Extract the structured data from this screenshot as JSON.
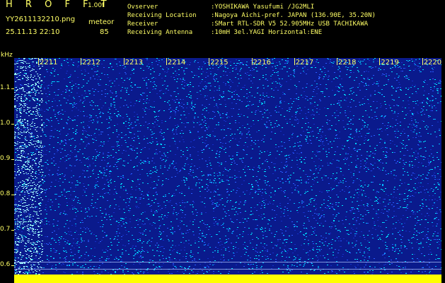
{
  "header": {
    "title": "H R O F F T",
    "version": "1.00f",
    "filename": "YY2611132210.png",
    "datetime": "25.11.13 22:10",
    "meteor_label": "meteor",
    "meteor_count": "85"
  },
  "info": [
    {
      "label": "Ovserver",
      "value": ":YOSHIKAWA Yasufumi /JG2MLI"
    },
    {
      "label": "Receiving Location",
      "value": ":Nagoya Aichi-pref. JAPAN (136.90E, 35.20N)"
    },
    {
      "label": "Receiver",
      "value": ":SMart RTL-SDR V5 52.905MHz USB TACHIKAWA"
    },
    {
      "label": "Receiving Antenna",
      "value": ":10mH 3el.YAGI Horizontal:ENE"
    }
  ],
  "axis": {
    "y_unit": "kHz",
    "y_ticks": [
      "1.1",
      "1.0",
      "0.9",
      "0.8",
      "0.7",
      "0.6"
    ],
    "x_ticks": [
      "2211",
      "2212",
      "2213",
      "2214",
      "2215",
      "2216",
      "2217",
      "2218",
      "2219",
      "2220"
    ]
  },
  "colors": {
    "text": "#ffff66",
    "background": "#000000",
    "waterfall_base": "#0a1a8c",
    "waterfall_hot": "#00e5ff",
    "bottom_bar": "#ffff00"
  }
}
